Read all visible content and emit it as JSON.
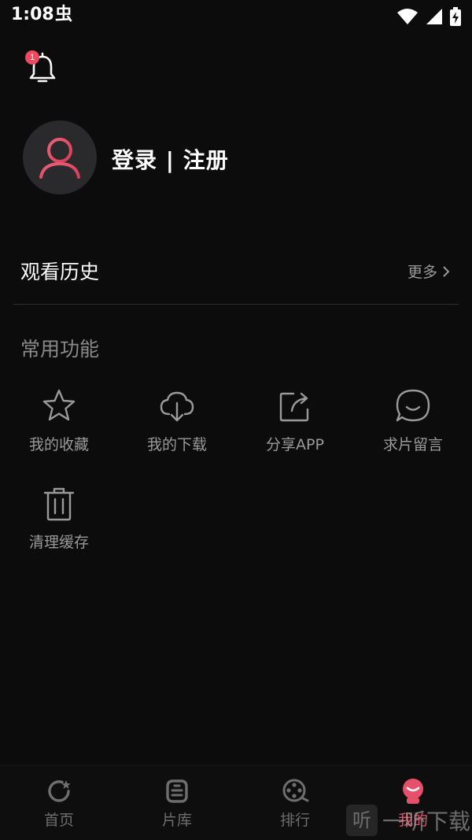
{
  "status_bar": {
    "time": "1:08",
    "app_glyph": "虫",
    "icons": [
      "wifi-icon",
      "cellular-signal-icon",
      "battery-charging-icon"
    ]
  },
  "notifications": {
    "icon": "bell-icon",
    "badge_count": "1"
  },
  "profile": {
    "avatar_icon": "user-icon",
    "login_text": "登录 | 注册"
  },
  "history": {
    "title": "观看历史",
    "more_label": "更多"
  },
  "functions": {
    "title": "常用功能",
    "items": [
      {
        "label": "我的收藏",
        "icon": "star-icon"
      },
      {
        "label": "我的下载",
        "icon": "cloud-download-icon"
      },
      {
        "label": "分享APP",
        "icon": "share-icon"
      },
      {
        "label": "求片留言",
        "icon": "chat-bubble-icon"
      },
      {
        "label": "清理缓存",
        "icon": "trash-icon"
      }
    ]
  },
  "bottom_nav": {
    "items": [
      {
        "label": "首页",
        "icon": "home-refresh-icon",
        "active": false
      },
      {
        "label": "片库",
        "icon": "library-icon",
        "active": false
      },
      {
        "label": "排行",
        "icon": "film-reel-icon",
        "active": false
      },
      {
        "label": "我的",
        "icon": "profile-icon",
        "active": true
      }
    ]
  },
  "watermark": {
    "glyph": "听",
    "text": "一听下载"
  },
  "colors": {
    "background": "#0c0c0c",
    "accent": "#e7506a",
    "badge": "#ef4a5f",
    "muted_text": "#9a9a9a"
  }
}
